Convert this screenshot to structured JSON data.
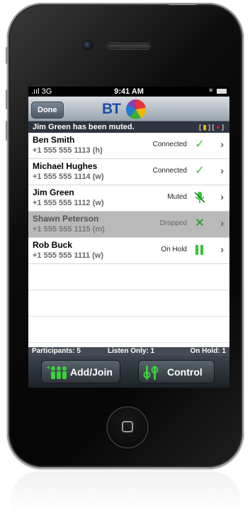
{
  "status_bar": {
    "signal": ".ııl 3G",
    "time": "9:41 AM",
    "bluetooth": "∗"
  },
  "nav": {
    "done_label": "Done",
    "logo_text": "BT"
  },
  "notice": {
    "text": "Jim Green has been muted.",
    "icons_text": "[  ] [  ]"
  },
  "participants": [
    {
      "name": "Ben Smith",
      "number": "+1 555 555 1113 (h)",
      "status": "Connected",
      "status_icon": "check-icon",
      "dimmed": false
    },
    {
      "name": "Michael Hughes",
      "number": "+1 555 555 1114 (w)",
      "status": "Connected",
      "status_icon": "check-icon",
      "dimmed": false
    },
    {
      "name": "Jim Green",
      "number": "+1 555 555 1112 (w)",
      "status": "Muted",
      "status_icon": "muted-mic-icon",
      "dimmed": false
    },
    {
      "name": "Shawn Peterson",
      "number": "+1 555 555 1115 (m)",
      "status": "Dropped",
      "status_icon": "cross-icon",
      "dimmed": true
    },
    {
      "name": "Rob Buck",
      "number": "+1 555 555 1111 (w)",
      "status": "On Hold",
      "status_icon": "pause-icon",
      "dimmed": false
    }
  ],
  "summary": {
    "participants": "Participants: 5",
    "listen_only": "Listen Only: 1",
    "on_hold": "On Hold: 1"
  },
  "toolbar": {
    "add_join_label": "Add/Join",
    "control_label": "Control"
  },
  "colors": {
    "accent_green": "#39d13a",
    "brand_blue": "#1b4fa8",
    "nav_gradient_top": "#d9dde2"
  }
}
